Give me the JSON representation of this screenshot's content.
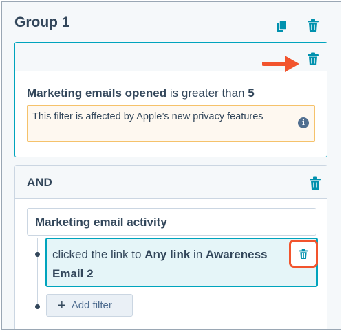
{
  "group": {
    "title": "Group 1",
    "copy_icon": "copy-icon",
    "delete_icon": "trash-icon"
  },
  "filter_card": {
    "property": "Marketing emails opened",
    "operator": "is greater than",
    "value": "5",
    "warning": "This filter is affected by Apple’s new privacy features",
    "info_icon": "i"
  },
  "and_card": {
    "label": "AND",
    "property": "Marketing email activity",
    "rule": {
      "prefix": "clicked the link to",
      "link": "Any link",
      "in_word": "in",
      "email": "Awareness Email 2"
    },
    "add_filter_label": "Add filter"
  },
  "colors": {
    "accent": "#00a4bd",
    "annotation": "#f2542d",
    "warning_bg": "#fef8f0",
    "warning_border": "#f5c26b"
  }
}
